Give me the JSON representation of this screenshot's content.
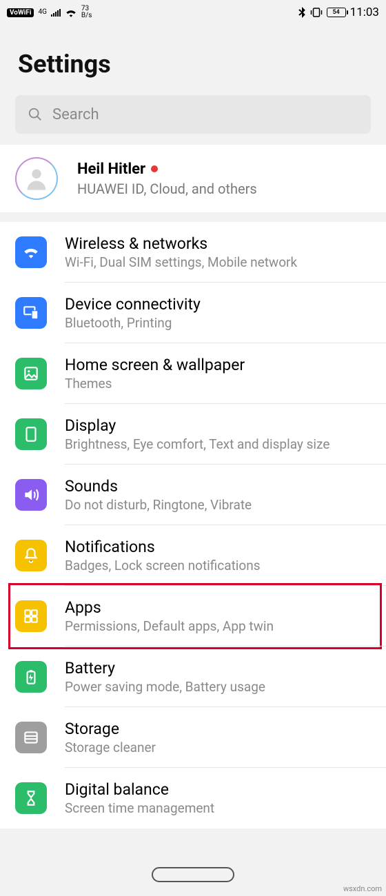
{
  "status": {
    "vowifi": "VoWiFi",
    "net_gen": "4G",
    "speed_top": "73",
    "speed_unit": "B/s",
    "battery": "54",
    "time": "11:03"
  },
  "page_title": "Settings",
  "search": {
    "placeholder": "Search"
  },
  "account": {
    "name": "Heil Hitler",
    "subtitle": "HUAWEI ID, Cloud, and others"
  },
  "rows": [
    {
      "title": "Wireless & networks",
      "subtitle": "Wi-Fi, Dual SIM settings, Mobile network",
      "icon": "wifi-icon",
      "color": "#2f7bff"
    },
    {
      "title": "Device connectivity",
      "subtitle": "Bluetooth, Printing",
      "icon": "devices-icon",
      "color": "#2f7bff"
    },
    {
      "title": "Home screen & wallpaper",
      "subtitle": "Themes",
      "icon": "wallpaper-icon",
      "color": "#2bbd6a"
    },
    {
      "title": "Display",
      "subtitle": "Brightness, Eye comfort, Text and display size",
      "icon": "display-icon",
      "color": "#2bbd6a"
    },
    {
      "title": "Sounds",
      "subtitle": "Do not disturb, Ringtone, Vibrate",
      "icon": "sound-icon",
      "color": "#8a5cf0"
    },
    {
      "title": "Notifications",
      "subtitle": "Badges, Lock screen notifications",
      "icon": "bell-icon",
      "color": "#f6c200"
    },
    {
      "title": "Apps",
      "subtitle": "Permissions, Default apps, App twin",
      "icon": "apps-icon",
      "color": "#f6c200",
      "highlighted": true
    },
    {
      "title": "Battery",
      "subtitle": "Power saving mode, Battery usage",
      "icon": "battery-icon",
      "color": "#2bbd6a"
    },
    {
      "title": "Storage",
      "subtitle": "Storage cleaner",
      "icon": "storage-icon",
      "color": "#9e9e9e"
    },
    {
      "title": "Digital balance",
      "subtitle": "Screen time management",
      "icon": "hourglass-icon",
      "color": "#2bbd6a"
    }
  ],
  "watermark": "wsxdn.com"
}
